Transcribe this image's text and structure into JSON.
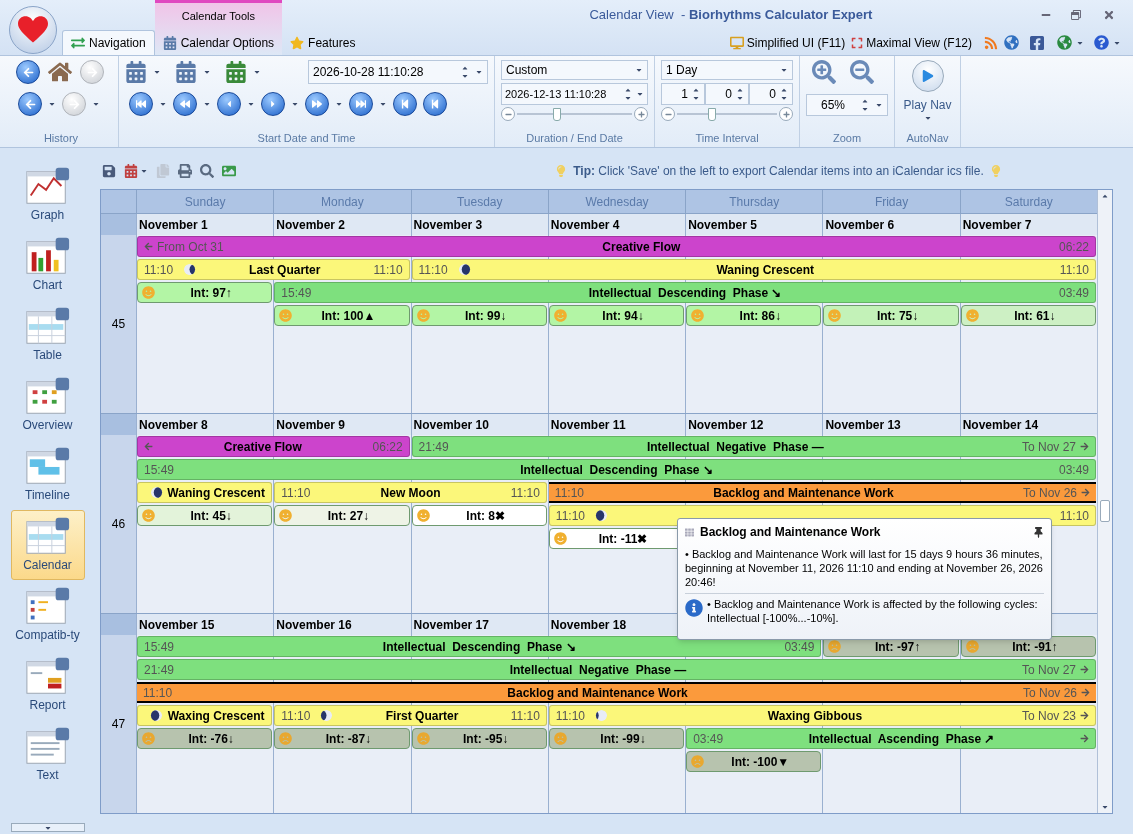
{
  "window": {
    "title": "Calendar View  - **Biorhythms Calculator Expert**"
  },
  "context_tab": "Calendar Tools",
  "tabs": [
    {
      "label": "Navigation",
      "selected": true
    },
    {
      "label": "Calendar Options",
      "selected": false
    },
    {
      "label": "Features",
      "selected": false
    }
  ],
  "quick_links": [
    "Simplified UI (F11)",
    "Maximal View (F12)"
  ],
  "ribbon": {
    "history": {
      "label": "History"
    },
    "start": {
      "label": "Start Date and Time",
      "value": "2026-10-28 11:10:28"
    },
    "duration": {
      "label": "Duration / End Date",
      "preset": "Custom",
      "end": "2026-12-13 11:10:28",
      "level": 0.35
    },
    "interval": {
      "label": "Time Interval",
      "preset": "1 Day",
      "parts": [
        "1",
        "0",
        "0"
      ],
      "level": 0.35
    },
    "zoom": {
      "label": "Zoom",
      "value": "65%"
    },
    "autonav": {
      "label": "AutoNav",
      "play": "Play Nav"
    }
  },
  "sidebar": [
    {
      "label": "Graph",
      "selected": false
    },
    {
      "label": "Chart",
      "selected": false
    },
    {
      "label": "Table",
      "selected": false
    },
    {
      "label": "Overview",
      "selected": false
    },
    {
      "label": "Timeline",
      "selected": false
    },
    {
      "label": "Calendar",
      "selected": true
    },
    {
      "label": "Compatib-ty",
      "selected": false
    },
    {
      "label": "Report",
      "selected": false
    },
    {
      "label": "Text",
      "selected": false
    }
  ],
  "tip": "**Tip:** Click 'Save' on the left to export Calendar items into an iCalendar ics file.",
  "calendar": {
    "weekdays": [
      "Sunday",
      "Monday",
      "Tuesday",
      "Wednesday",
      "Thursday",
      "Friday",
      "Saturday"
    ],
    "weeks": [
      {
        "number": "45",
        "days": [
          "November 1",
          "November 2",
          "November 3",
          "November 4",
          "November 5",
          "November 6",
          "November 7"
        ],
        "lanes": [
          [
            {
              "kind": "event",
              "color": "#cc44cc",
              "arrow_in": true,
              "start": "From Oct 31",
              "title": "Creative Flow",
              "end": "06:22",
              "arrow_out": false,
              "selected": false
            },
            {
              "kind": "cont"
            },
            {
              "kind": "cont"
            },
            {
              "kind": "cont"
            },
            {
              "kind": "cont"
            },
            {
              "kind": "cont"
            },
            {
              "kind": "cont"
            }
          ],
          [
            {
              "kind": "event",
              "color": "#fbf77a",
              "arrow_in": false,
              "start": "11:10",
              "moon": {
                "kind": "last-quarter"
              },
              "title": "Last Quarter",
              "end": "11:10",
              "arrow_out": false,
              "selected": false
            },
            {
              "kind": "cont"
            },
            {
              "kind": "event",
              "color": "#fbf77a",
              "arrow_in": false,
              "start": "11:10",
              "moon": {
                "kind": "waning-crescent"
              },
              "title": "Waning Crescent",
              "end": "11:10",
              "arrow_out": false,
              "selected": false
            },
            {
              "kind": "cont"
            },
            {
              "kind": "cont"
            },
            {
              "kind": "cont"
            },
            {
              "kind": "cont"
            }
          ],
          [
            {
              "kind": "int",
              "face": {
                "kind": "happy"
              },
              "color": "#b3f5a5",
              "title": "Int: 97↑"
            },
            {
              "kind": "event",
              "color": "#7ee07e",
              "arrow_in": false,
              "start": "15:49",
              "title": "Intellectual  Descending  Phase ↘",
              "end": "03:49",
              "arrow_out": false,
              "selected": false
            },
            {
              "kind": "cont"
            },
            {
              "kind": "cont"
            },
            {
              "kind": "cont"
            },
            {
              "kind": "cont"
            },
            {
              "kind": "cont"
            }
          ],
          [
            {
              "kind": "gap"
            },
            {
              "kind": "int",
              "face": {
                "kind": "happy"
              },
              "color": "#b3f5a5",
              "title": "Int: 100▲"
            },
            {
              "kind": "int",
              "face": {
                "kind": "happy"
              },
              "color": "#b3f5a5",
              "title": "Int: 99↓"
            },
            {
              "kind": "int",
              "face": {
                "kind": "happy"
              },
              "color": "#b3f5a5",
              "title": "Int: 94↓"
            },
            {
              "kind": "int",
              "face": {
                "kind": "happy"
              },
              "color": "#b3f5a5",
              "title": "Int: 86↓"
            },
            {
              "kind": "int",
              "face": {
                "kind": "happy"
              },
              "color": "#c3f2b8",
              "title": "Int: 75↓"
            },
            {
              "kind": "int",
              "face": {
                "kind": "happy"
              },
              "color": "#cdf0c4",
              "title": "Int: 61↓"
            }
          ]
        ]
      },
      {
        "number": "46",
        "days": [
          "November 8",
          "November 9",
          "November 10",
          "November 11",
          "November 12",
          "November 13",
          "November 14"
        ],
        "lanes": [
          [
            {
              "kind": "event",
              "color": "#cc44cc",
              "arrow_in": true,
              "title": "Creative Flow",
              "end": "06:22",
              "arrow_out": false,
              "selected": false
            },
            {
              "kind": "cont"
            },
            {
              "kind": "event",
              "color": "#7ee07e",
              "arrow_in": false,
              "start": "21:49",
              "title": "Intellectual  Negative  Phase —",
              "end": "To Nov 27",
              "arrow_out": true,
              "selected": false
            },
            {
              "kind": "cont"
            },
            {
              "kind": "cont"
            },
            {
              "kind": "cont"
            },
            {
              "kind": "cont"
            }
          ],
          [
            {
              "kind": "event",
              "color": "#7ee07e",
              "arrow_in": false,
              "start": "15:49",
              "title": "Intellectual  Descending  Phase ↘",
              "end": "03:49",
              "arrow_out": false,
              "selected": false
            },
            {
              "kind": "cont"
            },
            {
              "kind": "cont"
            },
            {
              "kind": "cont"
            },
            {
              "kind": "cont"
            },
            {
              "kind": "cont"
            },
            {
              "kind": "cont"
            }
          ],
          [
            {
              "kind": "event",
              "color": "#fbf77a",
              "arrow_in": false,
              "moon": {
                "kind": "waning-crescent"
              },
              "title": "Waning Crescent",
              "arrow_out": false,
              "selected": false
            },
            {
              "kind": "event",
              "color": "#fbf77a",
              "arrow_in": false,
              "start": "11:10",
              "title": "New Moon",
              "end": "11:10",
              "arrow_out": false,
              "selected": false
            },
            {
              "kind": "cont"
            },
            {
              "kind": "event",
              "color": "#fb9a3c",
              "arrow_in": false,
              "start": "11:10",
              "title": "Backlog and Maintenance Work",
              "end": "To Nov 26",
              "arrow_out": true,
              "selected": true
            },
            {
              "kind": "cont"
            },
            {
              "kind": "cont"
            },
            {
              "kind": "cont"
            }
          ],
          [
            {
              "kind": "int",
              "face": {
                "kind": "happy"
              },
              "color": "#e3f3da",
              "title": "Int: 45↓"
            },
            {
              "kind": "int",
              "face": {
                "kind": "happy"
              },
              "color": "#eef3e6",
              "title": "Int: 27↓"
            },
            {
              "kind": "int",
              "face": {
                "kind": "happy"
              },
              "color": "#ffffff",
              "title": "Int: 8✖"
            },
            {
              "kind": "event",
              "color": "#fbf77a",
              "arrow_in": false,
              "start": "11:10",
              "moon": {
                "kind": "waxing-crescent"
              },
              "end": "11:10",
              "arrow_out": false,
              "selected": false
            },
            {
              "kind": "cont"
            },
            {
              "kind": "cont"
            },
            {
              "kind": "cont"
            }
          ],
          [
            {
              "kind": "gap"
            },
            {
              "kind": "gap"
            },
            {
              "kind": "gap"
            },
            {
              "kind": "int",
              "face": {
                "kind": "happy"
              },
              "color": "#ffffff",
              "title": "Int: -11✖"
            },
            {
              "kind": "gap"
            },
            {
              "kind": "gap"
            },
            {
              "kind": "gap"
            }
          ]
        ]
      },
      {
        "number": "47",
        "days": [
          "November 15",
          "November 16",
          "November 17",
          "November 18"
        ],
        "lanes": [
          [
            {
              "kind": "event",
              "color": "#7ee07e",
              "arrow_in": false,
              "start": "15:49",
              "title": "Intellectual  Descending  Phase ↘",
              "end": "03:49",
              "arrow_out": false,
              "selected": false
            },
            {
              "kind": "cont"
            },
            {
              "kind": "cont"
            },
            {
              "kind": "cont"
            },
            {
              "kind": "cont"
            },
            {
              "kind": "int",
              "face": {
                "kind": "sad"
              },
              "color": "#b7c3ae",
              "title": "Int: -97↑"
            },
            {
              "kind": "int",
              "face": {
                "kind": "sad"
              },
              "color": "#b7c3ae",
              "title": "Int: -91↑"
            }
          ],
          [
            {
              "kind": "event",
              "color": "#7ee07e",
              "arrow_in": false,
              "start": "21:49",
              "title": "Intellectual  Negative  Phase —",
              "end": "To Nov 27",
              "arrow_out": true,
              "selected": false
            },
            {
              "kind": "cont"
            },
            {
              "kind": "cont"
            },
            {
              "kind": "cont"
            },
            {
              "kind": "cont"
            },
            {
              "kind": "cont"
            },
            {
              "kind": "cont"
            }
          ],
          [
            {
              "kind": "event",
              "color": "#fb9a3c",
              "arrow_in": false,
              "start": "11:10",
              "title": "Backlog and Maintenance Work",
              "end": "To Nov 26",
              "arrow_out": true,
              "selected": true
            },
            {
              "kind": "cont"
            },
            {
              "kind": "cont"
            },
            {
              "kind": "cont"
            },
            {
              "kind": "cont"
            },
            {
              "kind": "cont"
            },
            {
              "kind": "cont"
            }
          ],
          [
            {
              "kind": "event",
              "color": "#fbf77a",
              "arrow_in": false,
              "moon": {
                "kind": "waxing-crescent"
              },
              "title": "Waxing Crescent",
              "arrow_out": false,
              "selected": false
            },
            {
              "kind": "event",
              "color": "#fbf77a",
              "arrow_in": false,
              "start": "11:10",
              "moon": {
                "kind": "first-quarter"
              },
              "title": "First Quarter",
              "end": "11:10",
              "arrow_out": false,
              "selected": false
            },
            {
              "kind": "cont"
            },
            {
              "kind": "event",
              "color": "#fbf77a",
              "arrow_in": false,
              "start": "11:10",
              "moon": {
                "kind": "waxing-gibbous"
              },
              "title": "Waxing Gibbous",
              "end": "To Nov 23",
              "arrow_out": true,
              "selected": false
            },
            {
              "kind": "cont"
            },
            {
              "kind": "cont"
            },
            {
              "kind": "cont"
            }
          ],
          [
            {
              "kind": "int",
              "face": {
                "kind": "sad"
              },
              "color": "#b7c3ae",
              "title": "Int: -76↓"
            },
            {
              "kind": "int",
              "face": {
                "kind": "sad"
              },
              "color": "#b7c3ae",
              "title": "Int: -87↓"
            },
            {
              "kind": "int",
              "face": {
                "kind": "sad"
              },
              "color": "#b7c3ae",
              "title": "Int: -95↓"
            },
            {
              "kind": "int",
              "face": {
                "kind": "sad"
              },
              "color": "#b7c3ae",
              "title": "Int: -99↓"
            },
            {
              "kind": "event",
              "color": "#7ee07e",
              "arrow_in": false,
              "start": "03:49",
              "title": "Intellectual  Ascending  Phase ↗",
              "arrow_out": true,
              "selected": false
            },
            {
              "kind": "cont"
            },
            {
              "kind": "cont"
            }
          ],
          [
            {
              "kind": "gap"
            },
            {
              "kind": "gap"
            },
            {
              "kind": "gap"
            },
            {
              "kind": "gap"
            },
            {
              "kind": "int",
              "face": {
                "kind": "sad"
              },
              "color": "#b7c3ae",
              "title": "Int: -100▼"
            },
            {
              "kind": "gap"
            },
            {
              "kind": "gap"
            }
          ]
        ]
      }
    ]
  },
  "tooltip": {
    "title": "Backlog and Maintenance Work",
    "body": "• Backlog and Maintenance Work will last for 15 days 9 hours 36 minutes, beginning at November 11, 2026 11:10 and ending at November 26, 2026 20:46!",
    "note": "• Backlog and Maintenance Work is affected by the following cycles: Intellectual [-100%...-10%]."
  }
}
